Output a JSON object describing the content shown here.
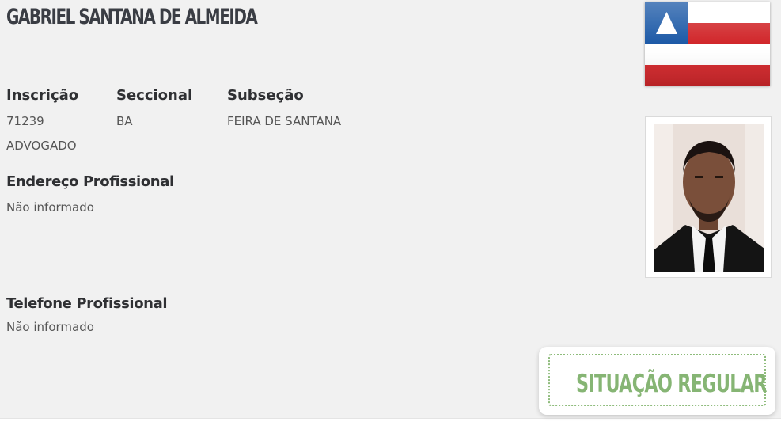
{
  "profile": {
    "name": "GABRIEL SANTANA DE ALMEIDA",
    "inscricao_label": "Inscrição",
    "inscricao_value": "71239",
    "seccional_label": "Seccional",
    "seccional_value": "BA",
    "subsecao_label": "Subseção",
    "subsecao_value": "FEIRA DE SANTANA",
    "tipo": "ADVOGADO",
    "endereco_label": "Endereço Profissional",
    "endereco_value": "Não informado",
    "telefone_label": "Telefone Profissional",
    "telefone_value": "Não informado"
  },
  "flag": {
    "icon": "bahia-state-flag-icon",
    "colors": {
      "blue": "#1d5aa7",
      "red": "#d1272b",
      "white": "#ffffff"
    }
  },
  "photo": {
    "icon": "lawyer-portrait-photo"
  },
  "status": {
    "label": "SITUAÇÃO REGULAR",
    "color": "#86b574"
  }
}
